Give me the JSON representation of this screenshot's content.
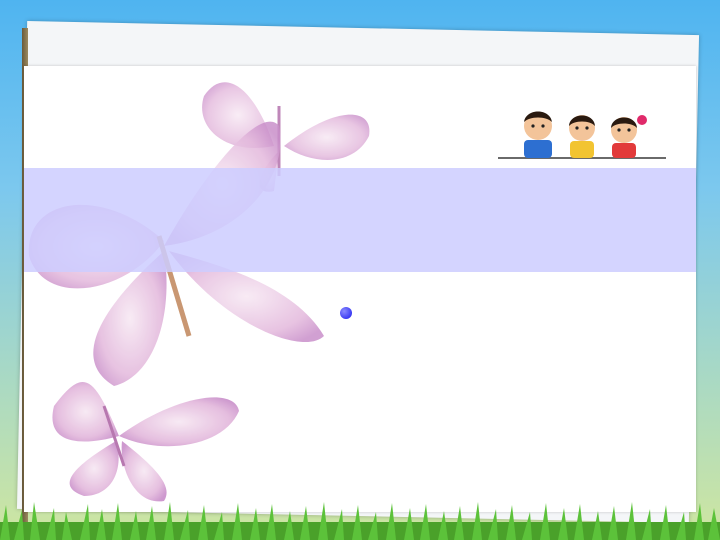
{
  "slide": {
    "title": "",
    "body": "",
    "colors": {
      "title": "#ff00cc",
      "body": "#1a1a9a",
      "band": "#ccccff",
      "bullet": "#2a2aee"
    }
  },
  "decor": {
    "illustration": "cartoon-children-icon",
    "background": "butterflies",
    "footer": "grass"
  }
}
